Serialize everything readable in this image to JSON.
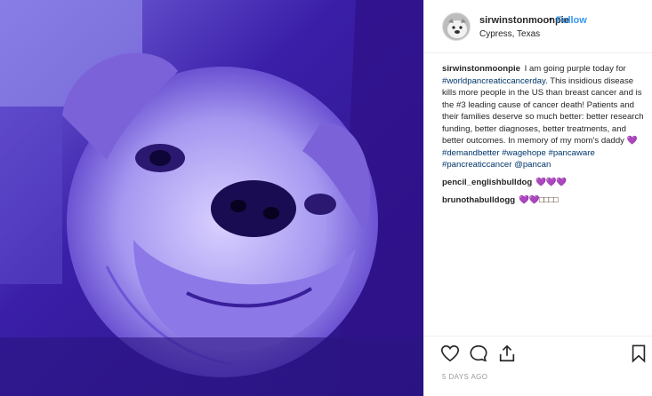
{
  "post": {
    "username": "sirwinstonmoonpie",
    "separator": "•",
    "follow_label": "Follow",
    "location": "Cypress, Texas",
    "avatar_icon": "bulldog-avatar-icon",
    "photo_icon": "bulldog-photo",
    "caption": {
      "user": "sirwinstonmoonpie",
      "t1": " I am going purple today for ",
      "h1": "#worldpancreaticcancerday",
      "t2": ". This insidious disease kills more people in the US than breast cancer and is the #3 leading cause of cancer death! Patients and their families deserve so much better: better research funding, better diagnoses, better treatments, and better outcomes. In memory of my mom's daddy 💜 ",
      "h2": "#demandbetter",
      "t3": " ",
      "h3": "#wagehope",
      "t4": " ",
      "h4": "#pancaware",
      "t5": " ",
      "h5": "#pancreaticcancer",
      "t6": " ",
      "h6": "@pancan"
    },
    "comments": [
      {
        "user": "pencil_englishbulldog",
        "text": "💜💜💜"
      },
      {
        "user": "brunothabulldogg",
        "text": "💜💜□□□□"
      }
    ],
    "actions": [
      "heart-icon",
      "comment-icon",
      "share-icon",
      "bookmark-icon"
    ],
    "date": "5 DAYS AGO"
  },
  "colors": {
    "photo_tint": "#4a2fc0",
    "link": "#003569",
    "follow": "#3897f0"
  }
}
